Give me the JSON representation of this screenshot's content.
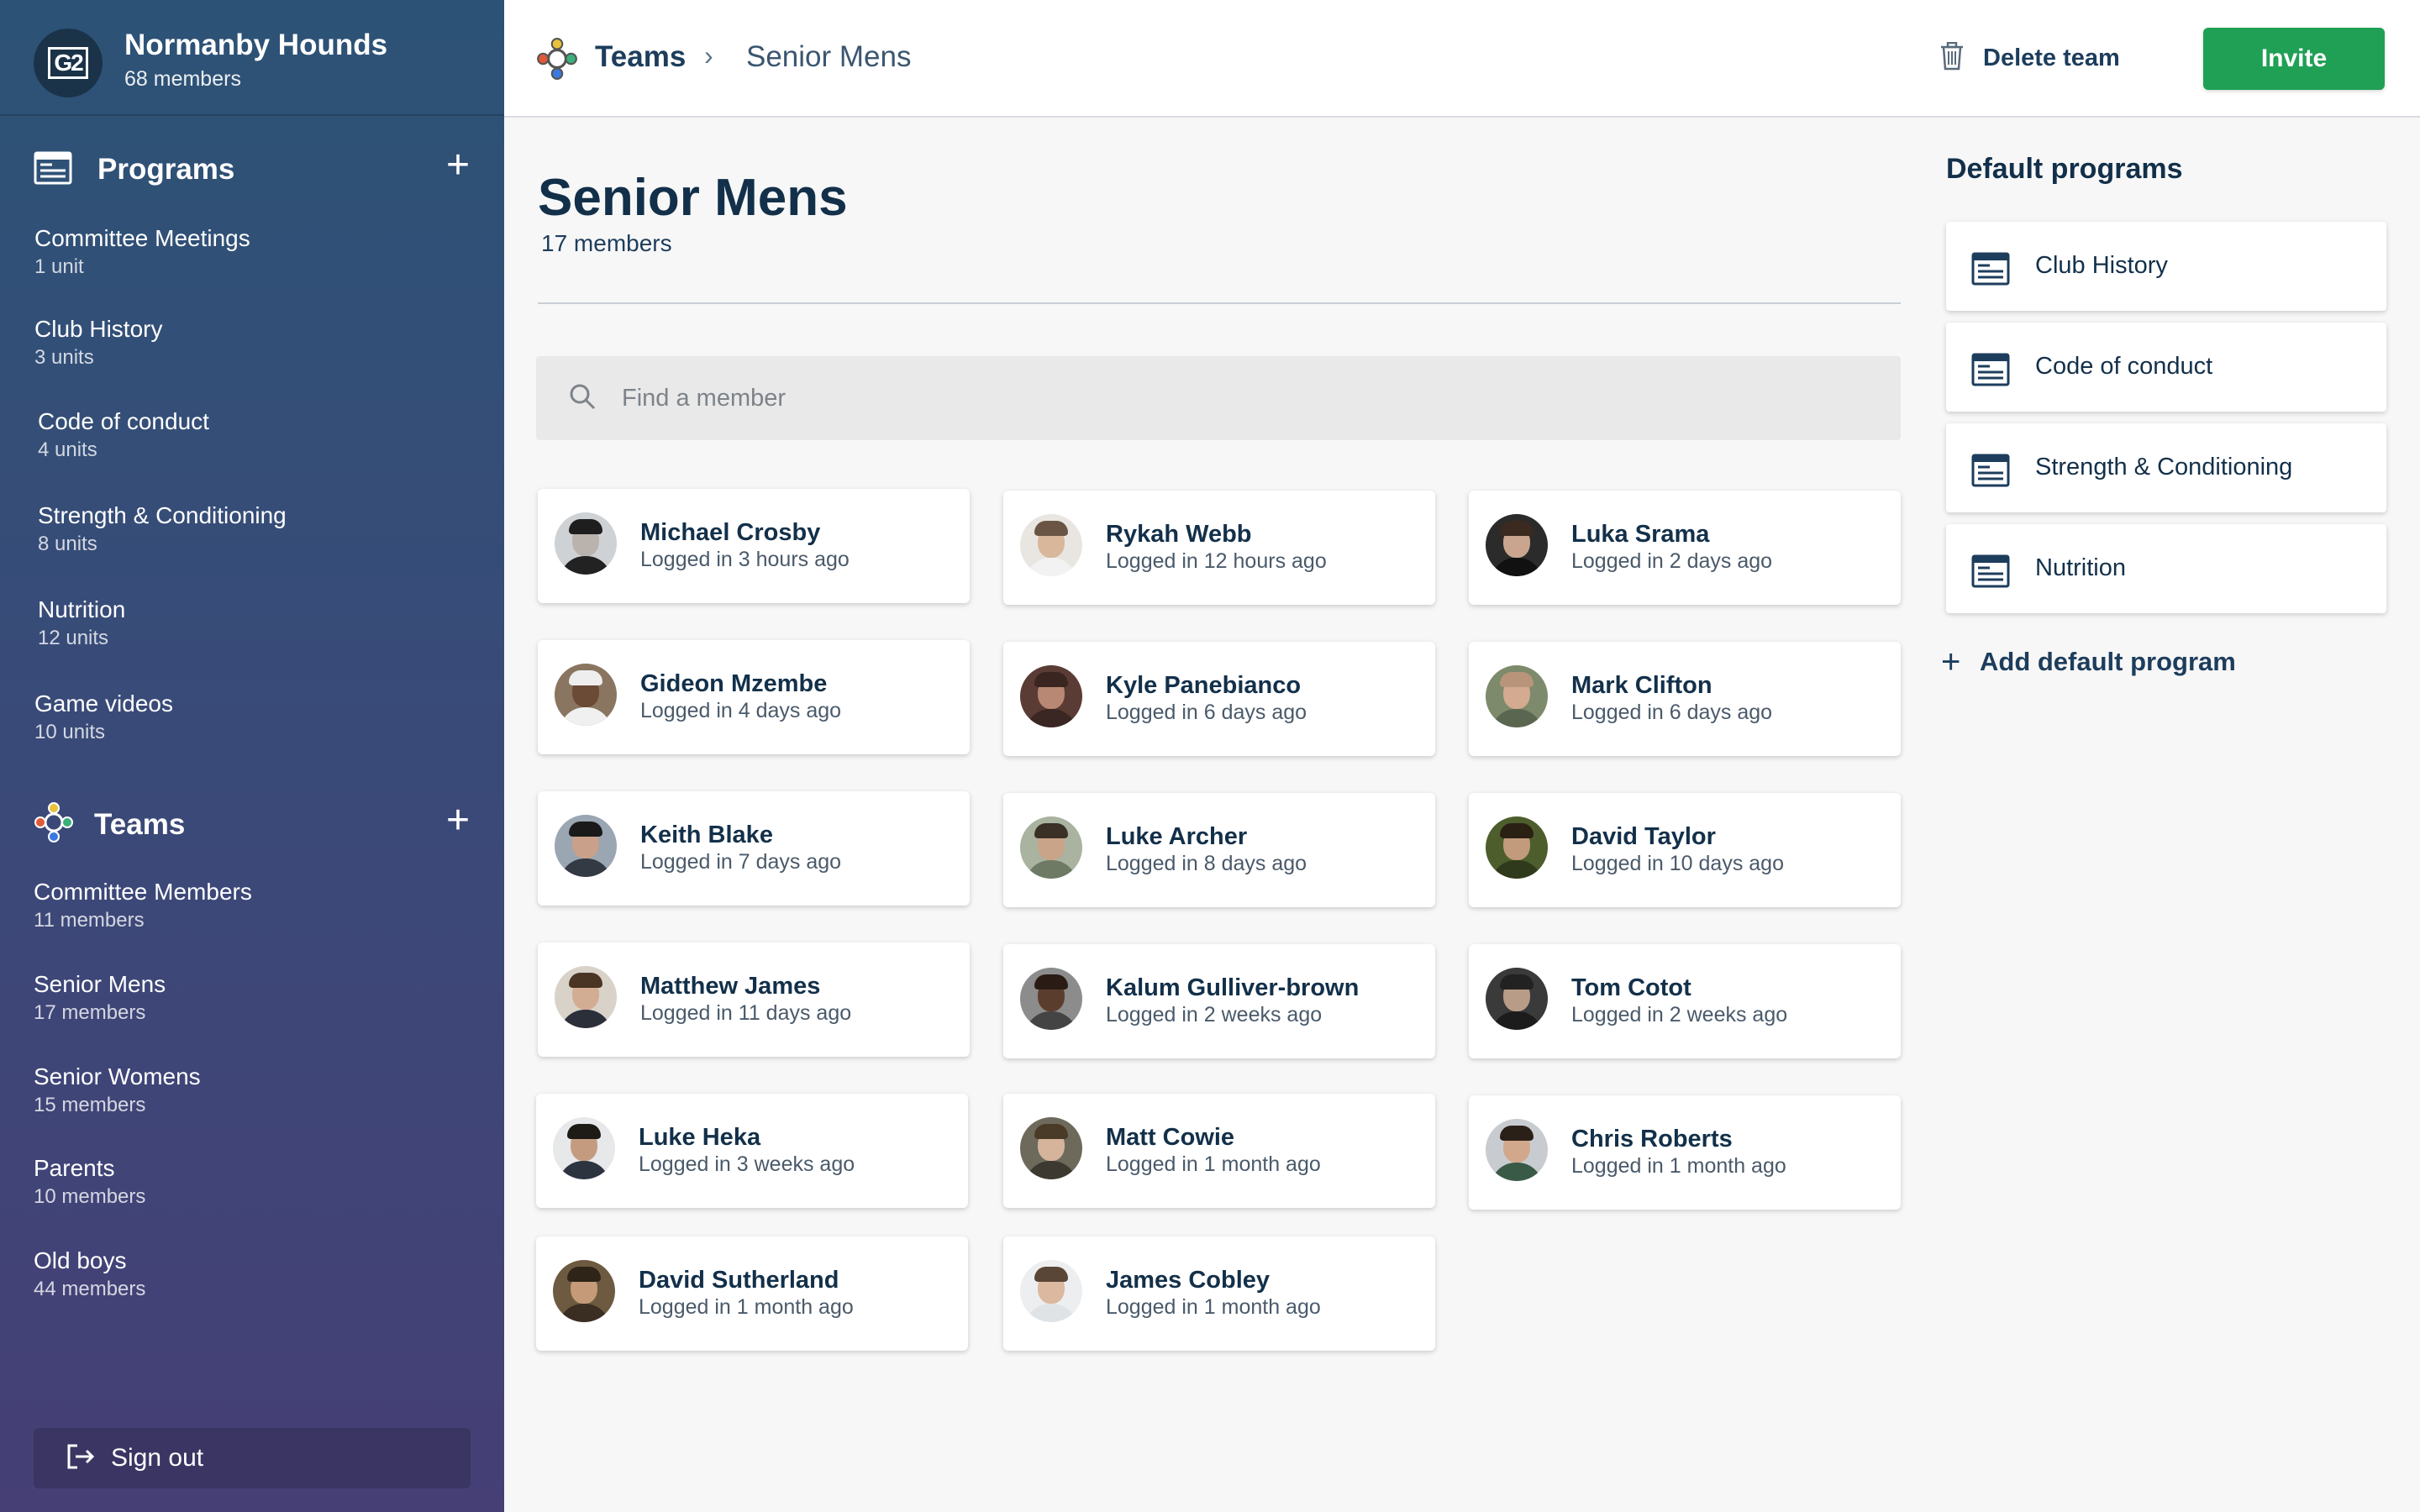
{
  "org": {
    "logo_text": "G2",
    "name": "Normanby Hounds",
    "member_count": "68 members"
  },
  "sidebar": {
    "programs_title": "Programs",
    "programs": [
      {
        "title": "Committee Meetings",
        "sub": "1 unit"
      },
      {
        "title": "Club History",
        "sub": "3 units"
      },
      {
        "title": "Code of conduct",
        "sub": "4 units"
      },
      {
        "title": "Strength & Conditioning",
        "sub": "8 units"
      },
      {
        "title": "Nutrition",
        "sub": "12 units"
      },
      {
        "title": "Game videos",
        "sub": "10 units"
      }
    ],
    "teams_title": "Teams",
    "teams": [
      {
        "title": "Committee Members",
        "sub": "11 members"
      },
      {
        "title": "Senior Mens",
        "sub": "17 members"
      },
      {
        "title": "Senior Womens",
        "sub": "15 members"
      },
      {
        "title": "Parents",
        "sub": "10 members"
      },
      {
        "title": "Old boys",
        "sub": "44 members"
      }
    ],
    "sign_out": "Sign out"
  },
  "topbar": {
    "breadcrumb_root": "Teams",
    "breadcrumb_sep": "›",
    "breadcrumb_current": "Senior Mens",
    "delete_label": "Delete team",
    "invite_label": "Invite"
  },
  "main": {
    "title": "Senior Mens",
    "subtitle": "17 members",
    "search_placeholder": "Find a member",
    "members": [
      {
        "name": "Michael Crosby",
        "status": "Logged in 3 hours ago"
      },
      {
        "name": "Rykah Webb",
        "status": "Logged in 12 hours ago"
      },
      {
        "name": "Luka Srama",
        "status": "Logged in 2 days ago"
      },
      {
        "name": "Gideon Mzembe",
        "status": "Logged in 4 days ago"
      },
      {
        "name": "Kyle Panebianco",
        "status": "Logged in 6 days ago"
      },
      {
        "name": "Mark Clifton",
        "status": "Logged in 6 days ago"
      },
      {
        "name": "Keith Blake",
        "status": "Logged in 7 days ago"
      },
      {
        "name": "Luke Archer",
        "status": "Logged in 8 days ago"
      },
      {
        "name": "David Taylor",
        "status": "Logged in 10 days ago"
      },
      {
        "name": "Matthew James",
        "status": "Logged in 11 days ago"
      },
      {
        "name": "Kalum Gulliver-brown",
        "status": "Logged in 2 weeks ago"
      },
      {
        "name": "Tom Cotot",
        "status": "Logged in 2 weeks ago"
      },
      {
        "name": "Luke Heka",
        "status": "Logged in 3 weeks ago"
      },
      {
        "name": "Matt Cowie",
        "status": "Logged in 1 month ago"
      },
      {
        "name": "Chris Roberts",
        "status": "Logged in 1 month ago"
      },
      {
        "name": "David Sutherland",
        "status": "Logged in 1 month ago"
      },
      {
        "name": "James Cobley",
        "status": "Logged in 1 month ago"
      }
    ]
  },
  "default_programs": {
    "title": "Default programs",
    "items": [
      "Club History",
      "Code of conduct",
      "Strength & Conditioning",
      "Nutrition"
    ],
    "add_label": "Add default program"
  },
  "colors": {
    "accent_green": "#1fa055",
    "navy": "#13304a",
    "sidebar_top": "#2c5376",
    "sidebar_bottom": "#453f76"
  },
  "icons": {
    "program": "document-icon",
    "team": "team-icon",
    "search": "search-icon",
    "delete": "trash-icon",
    "add": "plus-icon",
    "sign_out": "sign-out-icon"
  }
}
